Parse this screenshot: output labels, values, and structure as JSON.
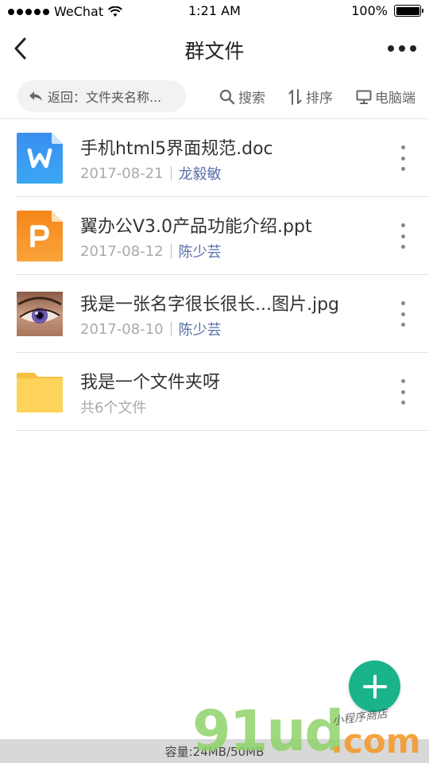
{
  "status_bar": {
    "carrier": "WeChat",
    "time": "1:21 AM",
    "battery": "100%",
    "battery_level": 1.0
  },
  "nav": {
    "title": "群文件"
  },
  "toolbar": {
    "back_label": "返回：文件夹名称...",
    "search_label": "搜索",
    "sort_label": "排序",
    "pc_label": "电脑端"
  },
  "files": [
    {
      "name": "手机html5界面规范.doc",
      "date": "2017-08-21",
      "author": "龙毅敏",
      "icon": "word-doc-icon"
    },
    {
      "name": "翼办公V3.0产品功能介绍.ppt",
      "date": "2017-08-12",
      "author": "陈少芸",
      "icon": "powerpoint-icon"
    },
    {
      "name": "我是一张名字很长很长...图片.jpg",
      "date": "2017-08-10",
      "author": "陈少芸",
      "icon": "image-thumbnail"
    },
    {
      "name": "我是一个文件夹呀",
      "meta": "共6个文件",
      "icon": "folder-icon"
    }
  ],
  "footer": {
    "capacity": "容量:24MB/50MB"
  },
  "watermark": {
    "logo": "91ud",
    "domain": ".com",
    "tagline": "小程序商店"
  },
  "colors": {
    "fab": "#1bb38a",
    "author_link": "#5a6fa8",
    "word_blue": "#2f8fe8",
    "ppt_orange": "#f7921e",
    "folder_yellow": "#fdd35a"
  }
}
